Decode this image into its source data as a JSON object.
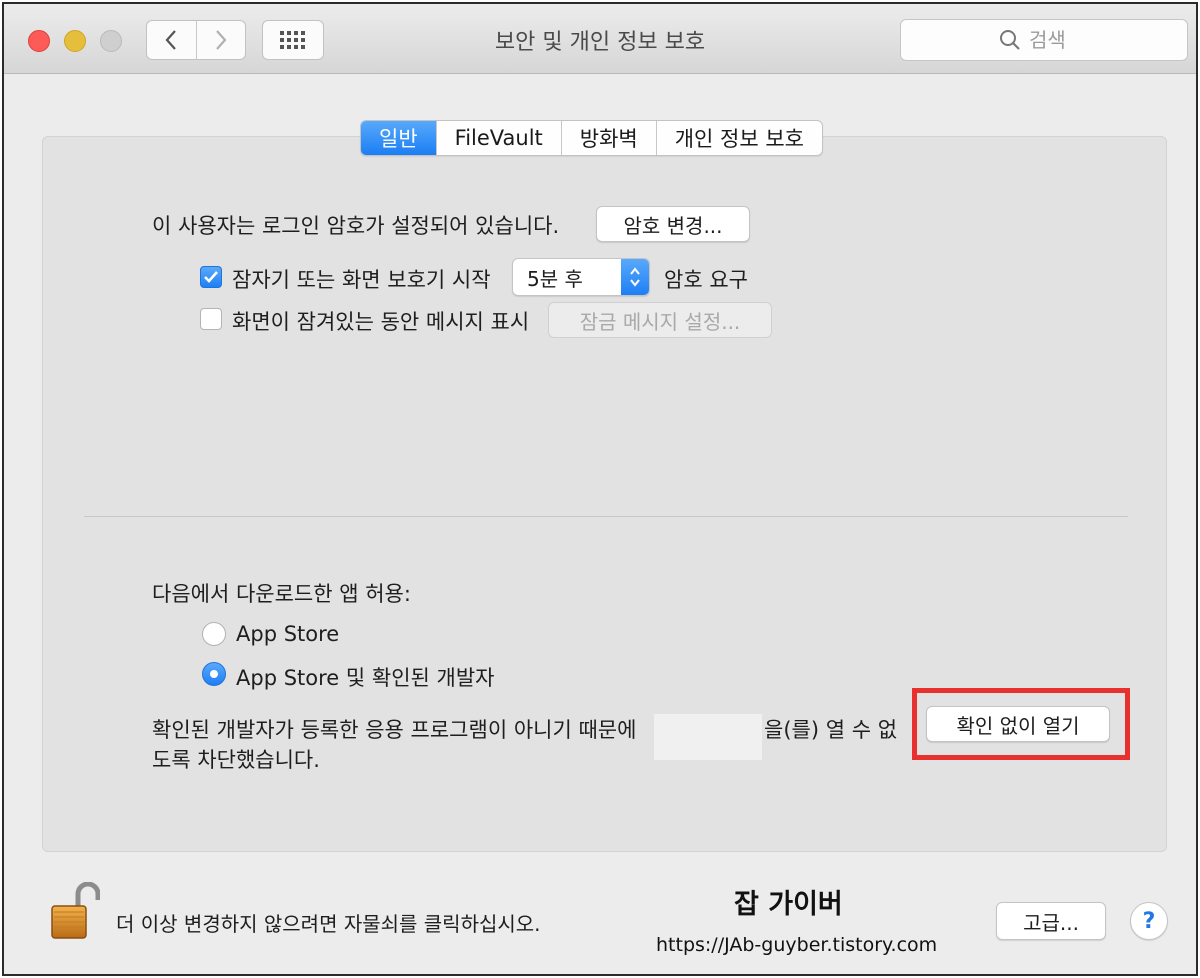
{
  "window": {
    "title": "보안 및 개인 정보 보호",
    "search_placeholder": "검색"
  },
  "tabs": [
    {
      "label": "일반",
      "active": true
    },
    {
      "label": "FileVault",
      "active": false
    },
    {
      "label": "방화벽",
      "active": false
    },
    {
      "label": "개인 정보 보호",
      "active": false
    }
  ],
  "general": {
    "password_status": "이 사용자는 로그인 암호가 설정되어 있습니다.",
    "change_password_button": "암호 변경...",
    "require_password_label": "잠자기 또는 화면 보호기 시작",
    "require_password_checked": true,
    "require_password_delay": "5분 후",
    "require_password_suffix": "암호 요구",
    "show_message_label": "화면이 잠겨있는 동안 메시지 표시",
    "show_message_checked": false,
    "lock_message_button": "잠금 메시지 설정..."
  },
  "downloads": {
    "heading": "다음에서 다운로드한 앱 허용:",
    "options": [
      {
        "label": "App Store",
        "selected": false
      },
      {
        "label": "App Store 및 확인된 개발자",
        "selected": true
      }
    ],
    "blocked_message_line1_prefix": "확인된 개발자가 등록한 응용 프로그램이 아니기 때문에",
    "blocked_message_line1_suffix": "을(를) 열 수 없",
    "blocked_message_line2": "도록 차단했습니다.",
    "open_anyway_button": "확인 없이 열기"
  },
  "footer": {
    "lock_text": "더 이상 변경하지 않으려면 자물쇠를 클릭하십시오.",
    "advanced_button": "고급...",
    "help_button": "?"
  },
  "watermark": {
    "title": "잡 가이버",
    "url": "https://JAb-guyber.tistory.com"
  },
  "colors": {
    "accent_blue": "#1e7ff4",
    "highlight_red": "#e8302f"
  }
}
